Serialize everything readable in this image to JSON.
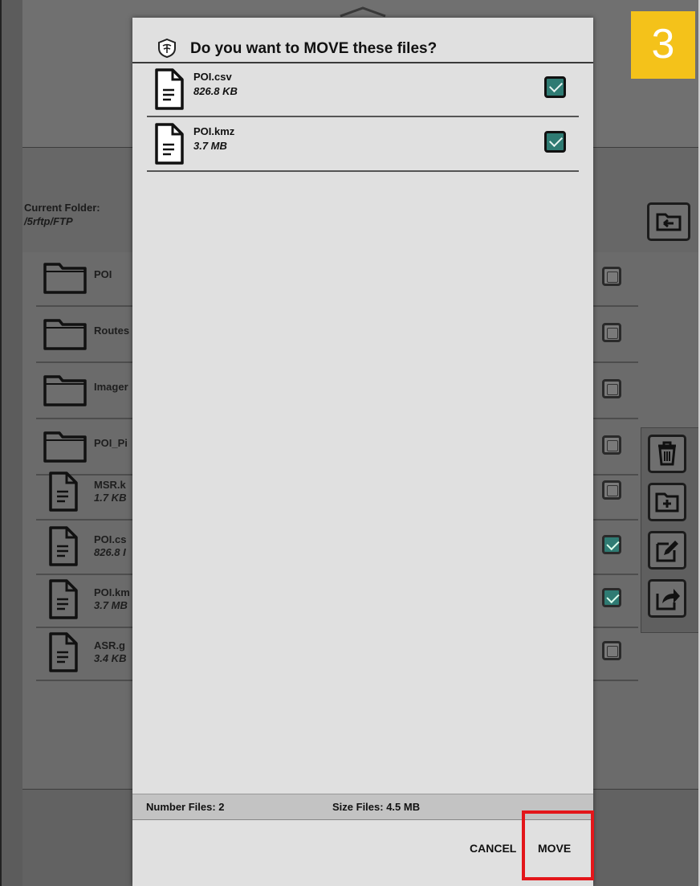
{
  "step_badge": "3",
  "background": {
    "current_folder_label": "Current Folder:",
    "current_folder_path": "/5rftp/FTP",
    "items": [
      {
        "type": "folder",
        "name": "POI",
        "size": "",
        "checked": false
      },
      {
        "type": "folder",
        "name": "Routes",
        "size": "",
        "checked": false
      },
      {
        "type": "folder",
        "name": "Imager",
        "size": "",
        "checked": false
      },
      {
        "type": "folder",
        "name": "POI_Pi",
        "size": "",
        "checked": false
      },
      {
        "type": "file",
        "name": "MSR.k",
        "size": "1.7 KB",
        "checked": false
      },
      {
        "type": "file",
        "name": "POI.cs",
        "size": "826.8 I",
        "checked": true
      },
      {
        "type": "file",
        "name": "POI.km",
        "size": "3.7 MB",
        "checked": true
      },
      {
        "type": "file",
        "name": "ASR.g",
        "size": "3.4 KB",
        "checked": false
      }
    ],
    "tool_icons": [
      "folder-up-icon",
      "trash-icon",
      "new-folder-icon",
      "rename-icon",
      "share-icon"
    ]
  },
  "dialog": {
    "title": "Do you want to MOVE these files?",
    "files": [
      {
        "name": "POI.csv",
        "size": "826.8 KB",
        "checked": true
      },
      {
        "name": "POI.kmz",
        "size": "3.7 MB",
        "checked": true
      }
    ],
    "number_files": "Number Files: 2",
    "size_files": "Size Files: 4.5 MB",
    "cancel_label": "CANCEL",
    "move_label": "MOVE"
  },
  "colors": {
    "accent_teal": "#2f7b73",
    "highlight_red": "#e3161a",
    "badge_yellow": "#f4c21a"
  }
}
